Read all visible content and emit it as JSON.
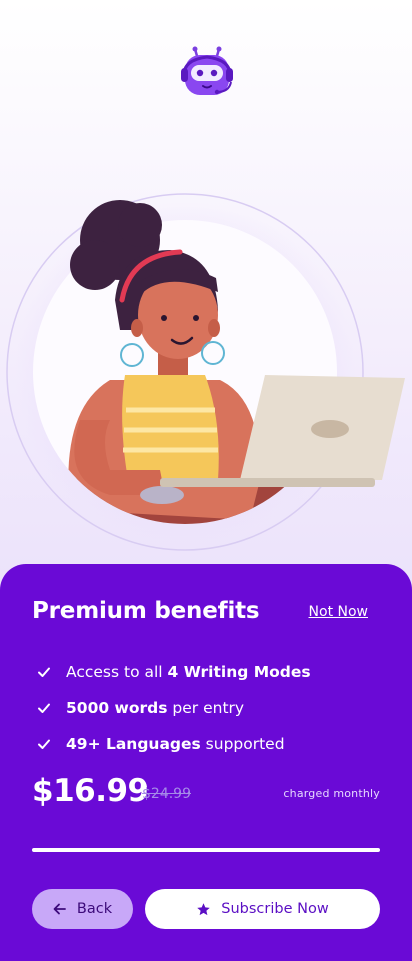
{
  "colors": {
    "primary": "#6a0ad6",
    "back_button_bg": "#c8a8f8",
    "old_price": "#a68be8"
  },
  "header": {
    "logo_icon": "robot-headset-mascot"
  },
  "hero": {
    "illustration": "woman-working-on-laptop"
  },
  "sheet": {
    "title": "Premium benefits",
    "not_now": "Not Now",
    "benefits": [
      {
        "pre": "Access to all ",
        "bold": "4 Writing Modes",
        "post": ""
      },
      {
        "pre": "",
        "bold": "5000 words",
        "post": " per entry"
      },
      {
        "pre": "",
        "bold": "49+ Languages",
        "post": " supported"
      }
    ],
    "price": "$16.99",
    "old_price": "$24.99",
    "billing_note": "charged monthly",
    "back_label": "Back",
    "subscribe_label": "Subscribe Now"
  }
}
